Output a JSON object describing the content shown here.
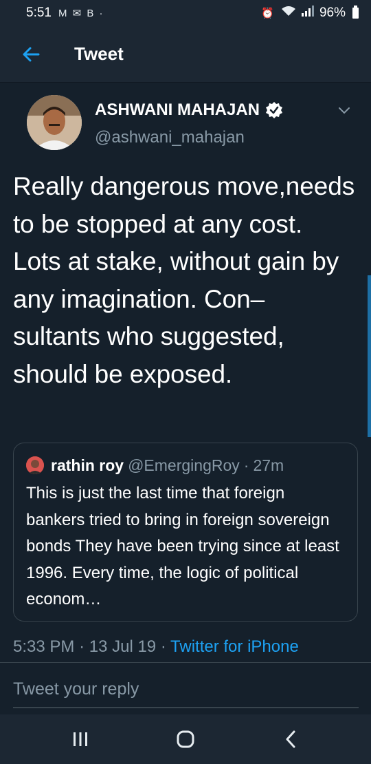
{
  "status_bar": {
    "time": "5:51",
    "notifications": "M ✉ B ·",
    "battery": "96%"
  },
  "header": {
    "title": "Tweet"
  },
  "tweet": {
    "author_name": "ASHWANI MAHAJAN",
    "author_handle": "@ashwani_mahajan",
    "text": "Really dangerous move,needs to be stopped at any cost. Lots at stake, without gain by any imagination. Con– sultants who suggested, should be exposed.",
    "time": "5:33 PM",
    "date": "13 Jul 19",
    "source": "Twitter for iPhone"
  },
  "quoted_tweet": {
    "author_name": "rathin roy",
    "author_handle": "@EmergingRoy",
    "time": "27m",
    "text": "This is just the last time that foreign bankers tried to bring in foreign sovereign bonds They have been trying since at least 1996.  Every time, the logic of political econom…"
  },
  "reply": {
    "placeholder": "Tweet your reply"
  },
  "colors": {
    "background": "#15202b",
    "header": "#1c2733",
    "accent": "#1da1f2",
    "muted": "#8899a6"
  }
}
